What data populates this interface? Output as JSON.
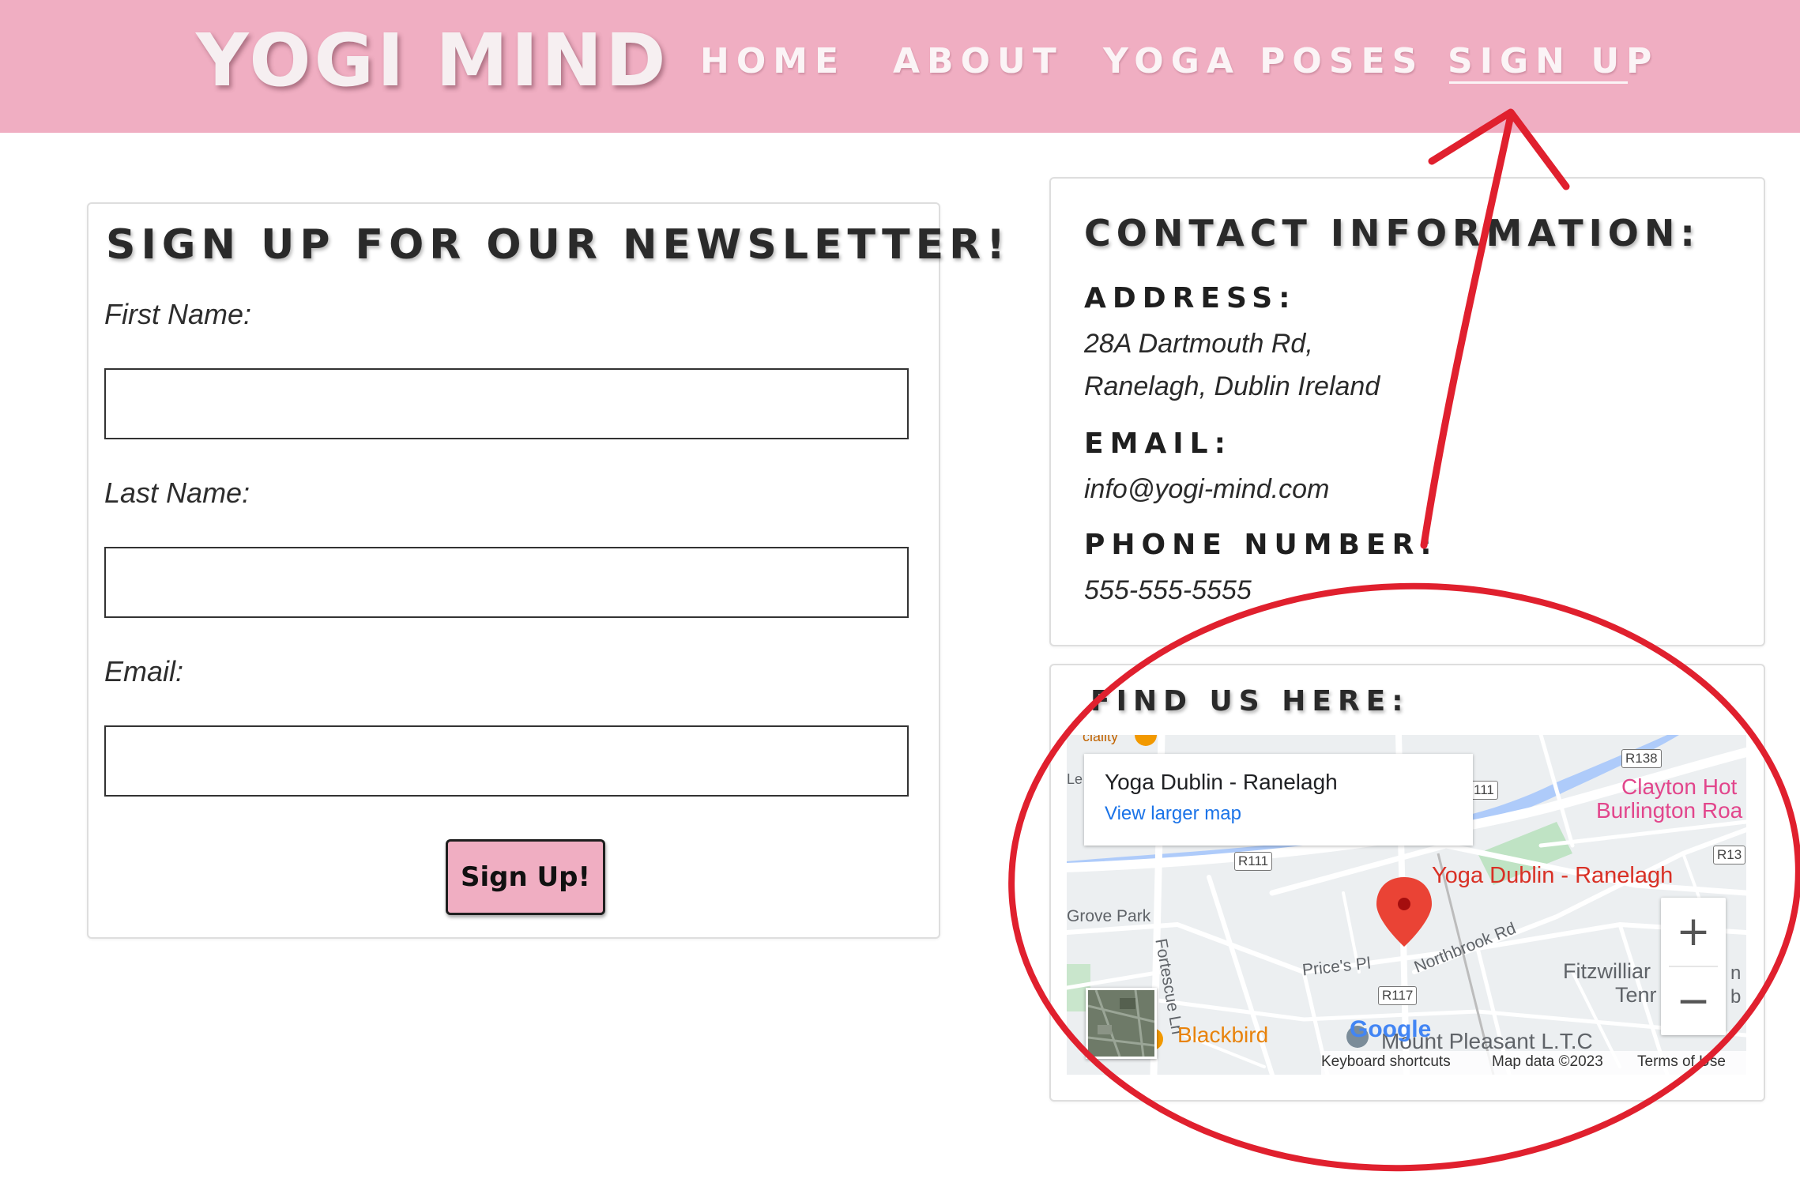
{
  "header": {
    "brand": "YOGI MIND",
    "nav": {
      "home": "HOME",
      "about": "ABOUT",
      "poses": "YOGA POSES",
      "signup": "SIGN UP"
    },
    "bg_color": "#f0aec2"
  },
  "newsletter": {
    "title": "SIGN UP FOR OUR NEWSLETTER!",
    "first_name_label": "First Name:",
    "first_name_value": "",
    "last_name_label": "Last Name:",
    "last_name_value": "",
    "email_label": "Email:",
    "email_value": "",
    "submit_label": "Sign Up!"
  },
  "contact": {
    "title": "CONTACT INFORMATION:",
    "address_label": "ADDRESS:",
    "address_line1": "28A Dartmouth Rd,",
    "address_line2": "Ranelagh, Dublin Ireland",
    "email_label": "EMAIL:",
    "email": "info@yogi-mind.com",
    "phone_label": "PHONE NUMBER:",
    "phone": "555-555-5555"
  },
  "find_us": {
    "title": "FIND US HERE:",
    "map": {
      "place_name": "Yoga Dublin - Ranelagh",
      "view_larger": "View larger map",
      "pin_label": "Yoga Dublin - Ranelagh",
      "labels": {
        "clayton_1": "Clayton Hot",
        "clayton_2": "Burlington Roa",
        "grove_park": "Grove Park",
        "fortescue": "Fortescue Ln",
        "prices_pl": "Price's Pl",
        "northbrook": "Northbrook Rd",
        "fitzwilliam_1": "Fitzwilliar",
        "fitzwilliam_2": "Tenr",
        "blackbird": "Blackbird",
        "mount_pleasant": "Mount Pleasant L.T.C",
        "top_fragment": "ciality",
        "left_fragment": "Le",
        "right_fragment_1": "n",
        "right_fragment_2": "b"
      },
      "shields": {
        "r138": "R138",
        "r111_top": "111",
        "r111": "R111",
        "r117": "R117",
        "r13": "R13"
      },
      "google": "Google",
      "footer": {
        "shortcuts": "Keyboard shortcuts",
        "data": "Map data ©2023",
        "terms": "Terms of Use"
      },
      "zoom_in": "+",
      "zoom_out": "−"
    }
  },
  "annotation_color": "#e0202e"
}
